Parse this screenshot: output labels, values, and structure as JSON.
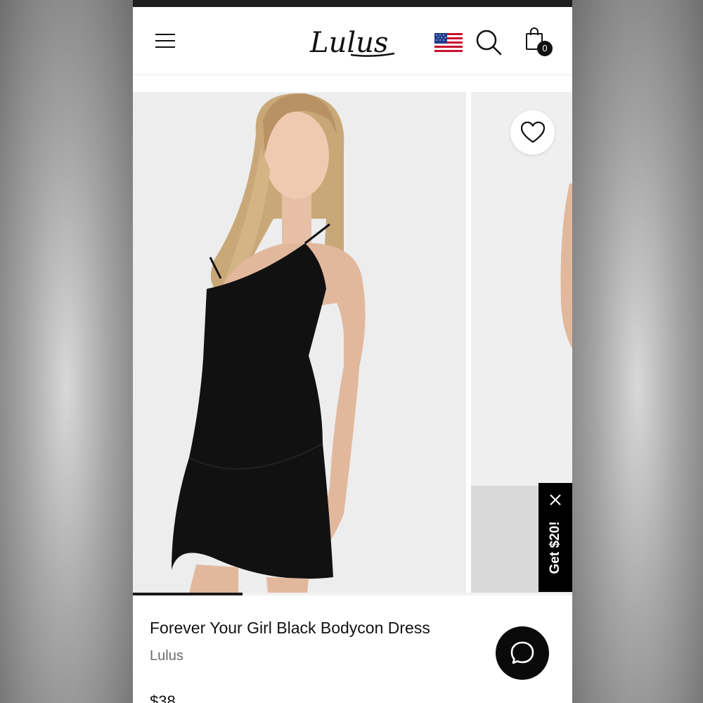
{
  "header": {
    "menu_icon": "hamburger-menu-icon",
    "logo_text": "Lulus",
    "region_flag": "us-flag-icon",
    "search_icon": "search-icon",
    "bag_icon": "shopping-bag-icon",
    "bag_count": "0"
  },
  "gallery": {
    "favorite_icon": "heart-outline-icon",
    "current_image_progress": 0.25
  },
  "promo": {
    "label": "Get $20!",
    "close_icon": "close-icon"
  },
  "product": {
    "title": "Forever Your Girl Black Bodycon Dress",
    "brand": "Lulus",
    "price": "$38"
  },
  "chat": {
    "icon": "chat-bubble-icon"
  },
  "colors": {
    "accent": "#000000",
    "background": "#ffffff",
    "brand_text": "#6b6b6b"
  }
}
